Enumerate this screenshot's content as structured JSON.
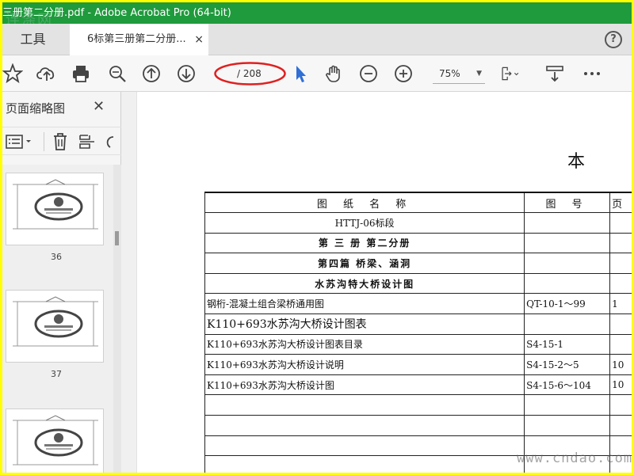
{
  "window": {
    "title": "三册第二分册.pdf - Adobe Acrobat Pro (64-bit)",
    "watermark_top": "连涤网"
  },
  "tabs": {
    "tools_label": "工具",
    "document_label": "6标第三册第二分册...",
    "close_glyph": "×",
    "help_glyph": "?"
  },
  "toolbar": {
    "page_total": "/ 208",
    "zoom": "75%",
    "zoom_arrow": "▼",
    "icons": [
      "star-icon",
      "cloud-upload-icon",
      "printer-icon",
      "zoom-search-icon",
      "page-up-icon",
      "page-down-icon",
      "select-cursor-icon",
      "hand-tool-icon",
      "zoom-out-icon",
      "zoom-in-icon",
      "fit-page-icon",
      "scroll-mode-icon",
      "more-icon"
    ],
    "highlight_color": "#e02020",
    "cursor_color": "#2f6fd6"
  },
  "left_panel": {
    "title": "页面缩略图",
    "close_glyph": "✕",
    "thumbnails": [
      {
        "label": "36"
      },
      {
        "label": "37"
      },
      {
        "label": ""
      }
    ]
  },
  "document": {
    "heading": "本",
    "table": {
      "header": [
        "图 纸 名 称",
        "图 号",
        "页"
      ],
      "rows": [
        [
          "HTTJ-06标段",
          "",
          ""
        ],
        [
          "第 三 册  第二分册",
          "",
          ""
        ],
        [
          "第四篇   桥梁、涵洞",
          "",
          ""
        ],
        [
          "水苏沟特大桥设计图",
          "",
          ""
        ],
        [
          "钢桁-混凝土组合梁桥通用图",
          "QT-10-1～99",
          "1"
        ],
        [
          "K110+693水苏沟大桥设计图表",
          "",
          ""
        ],
        [
          "K110+693水苏沟大桥设计图表目录",
          "S4-15-1",
          ""
        ],
        [
          "K110+693水苏沟大桥设计说明",
          "S4-15-2～5",
          "10"
        ],
        [
          "K110+693水苏沟大桥设计图",
          "S4-15-6～104",
          "10"
        ],
        [
          "",
          "",
          ""
        ],
        [
          "",
          "",
          ""
        ],
        [
          "",
          "",
          ""
        ],
        [
          "",
          "",
          ""
        ]
      ]
    },
    "watermark_bottom": "www.cndao.com"
  },
  "colors": {
    "titlebar": "#1f9a3c",
    "border_highlight": "#ffff00"
  }
}
